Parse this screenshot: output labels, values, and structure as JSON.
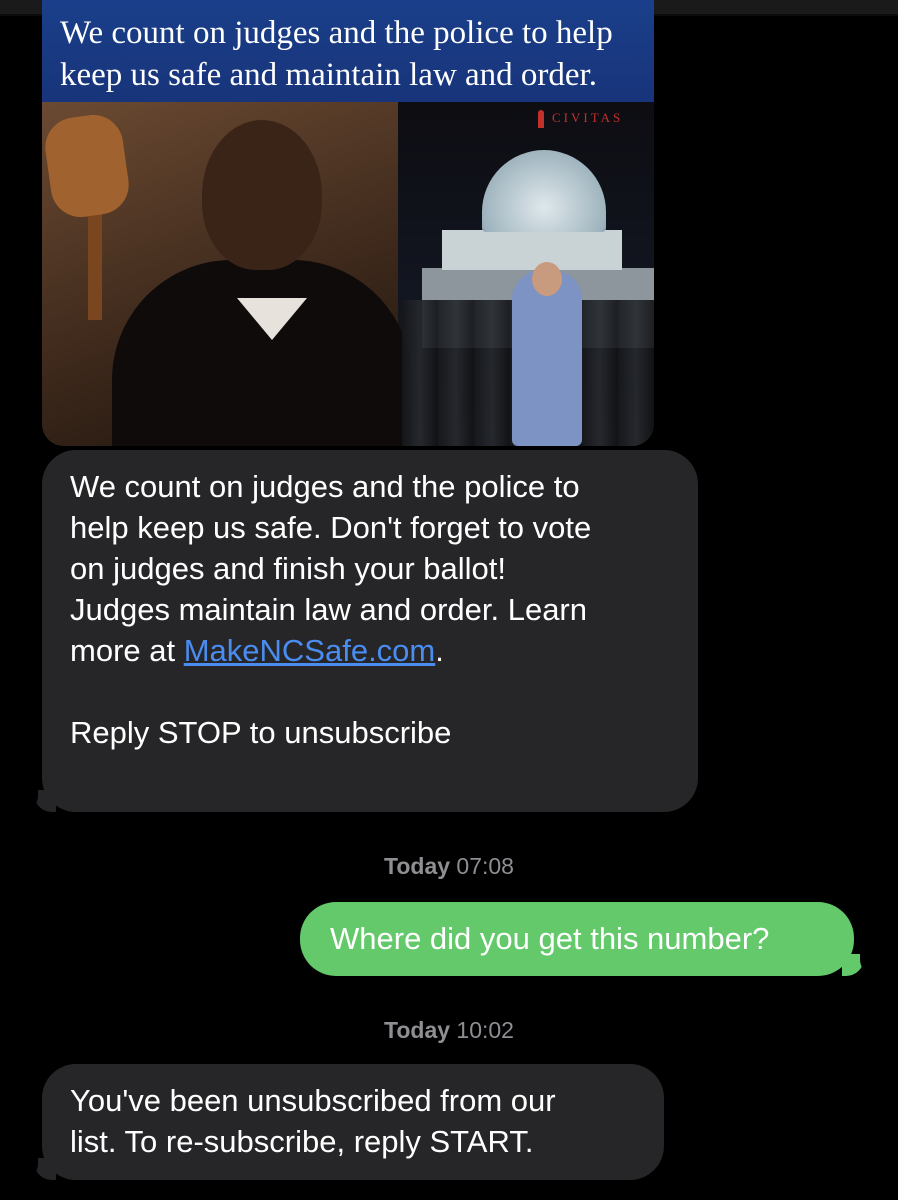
{
  "attachment": {
    "banner_line1": "We count on judges and the police to help",
    "banner_line2": "keep us safe and maintain law and order.",
    "logo_text": "CIVITAS"
  },
  "messages": [
    {
      "direction": "incoming",
      "line1": "We count on judges and the police to",
      "line2": "help keep us safe. Don't forget to vote",
      "line3": "on judges and finish your ballot!",
      "line4": "Judges maintain law and order. Learn",
      "line5_prefix": "more at ",
      "link": "MakeNCSafe.com",
      "line5_suffix": ".",
      "line6": "Reply STOP to unsubscribe"
    },
    {
      "direction": "outgoing",
      "text": "Where did you get this number?"
    },
    {
      "direction": "incoming",
      "line1": "You've been unsubscribed from our",
      "line2": "list. To re-subscribe, reply START."
    }
  ],
  "timestamps": [
    {
      "day": "Today",
      "time": "07:08"
    },
    {
      "day": "Today",
      "time": "10:02"
    }
  ],
  "colors": {
    "background": "#000000",
    "incoming_bubble": "#262628",
    "outgoing_bubble": "#63c96a",
    "link": "#4a8cf0",
    "timestamp": "#8e8e93"
  }
}
